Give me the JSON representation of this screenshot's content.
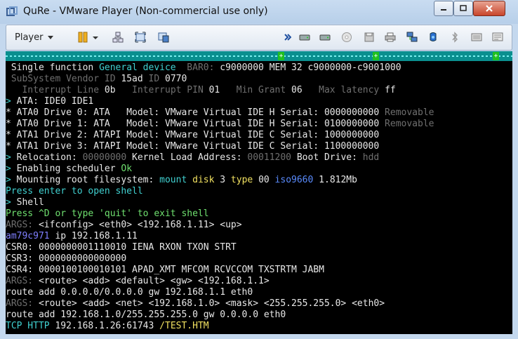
{
  "window": {
    "title": "QuRe - VMware Player (Non-commercial use only)",
    "controls": [
      "minimize",
      "maximize",
      "close"
    ]
  },
  "toolbar": {
    "player_label": "Player",
    "icons": [
      "pause-icon",
      "send-ctrl-alt-del-icon",
      "fullscreen-icon",
      "unity-icon",
      "arrows-icon",
      "hard-disk-icon",
      "hard-disk-2-icon",
      "cd-drive-icon",
      "floppy-icon",
      "network-icon",
      "usb-icon",
      "sound-icon",
      "bluetooth-icon",
      "printer-icon",
      "message-icon"
    ]
  },
  "terminal": {
    "lines": [
      [
        {
          "t": "Single function ",
          "c": "w",
          "p": " "
        },
        {
          "t": "General device",
          "c": "c"
        },
        {
          "t": "  BAR0: ",
          "c": "g"
        },
        {
          "t": "c9000000 MEM 32 c9000000-c9001000",
          "c": "w"
        }
      ],
      [
        {
          "t": "SubSystem Vendor ID ",
          "c": "g",
          "p": " "
        },
        {
          "t": "15ad",
          "c": "w"
        },
        {
          "t": " ID ",
          "c": "g"
        },
        {
          "t": "0770",
          "c": "w"
        }
      ],
      [
        {
          "t": "Interrupt Line ",
          "c": "g",
          "p": "   "
        },
        {
          "t": "0b",
          "c": "w"
        },
        {
          "t": "   Interrupt PIN ",
          "c": "g"
        },
        {
          "t": "01",
          "c": "w"
        },
        {
          "t": "   Min Grant ",
          "c": "g"
        },
        {
          "t": "06",
          "c": "w"
        },
        {
          "t": "   Max latency ",
          "c": "g"
        },
        {
          "t": "ff",
          "c": "w"
        }
      ],
      [
        {
          "t": ">",
          "c": "c"
        },
        {
          "t": " ATA: IDE0 IDE1",
          "c": "w"
        }
      ],
      [
        {
          "t": "*",
          "c": "w"
        },
        {
          "t": " ATA0 Drive 0: ATA   Model: VMware Virtual IDE H Serial: 0000000000 ",
          "c": "w"
        },
        {
          "t": "Removable",
          "c": "g"
        }
      ],
      [
        {
          "t": "*",
          "c": "w"
        },
        {
          "t": " ATA0 Drive 1: ATA   Model: VMware Virtual IDE H Serial: 0100000000 ",
          "c": "w"
        },
        {
          "t": "Removable",
          "c": "g"
        }
      ],
      [
        {
          "t": "*",
          "c": "w"
        },
        {
          "t": " ATA1 Drive 2: ATAPI Model: VMware Virtual IDE C Serial: 1000000000",
          "c": "w"
        }
      ],
      [
        {
          "t": "*",
          "c": "w"
        },
        {
          "t": " ATA1 Drive 3: ATAPI Model: VMware Virtual IDE C Serial: 1100000000",
          "c": "w"
        }
      ],
      [
        {
          "t": ">",
          "c": "c"
        },
        {
          "t": " Relocation: ",
          "c": "w"
        },
        {
          "t": "00000000",
          "c": "g"
        },
        {
          "t": " Kernel Load Address: ",
          "c": "w"
        },
        {
          "t": "00011200",
          "c": "g"
        },
        {
          "t": " Boot Drive: ",
          "c": "w"
        },
        {
          "t": "hdd",
          "c": "g"
        }
      ],
      [
        {
          "t": ">",
          "c": "c"
        },
        {
          "t": " Enabling scheduler ",
          "c": "w"
        },
        {
          "t": "Ok",
          "c": "gr"
        }
      ],
      [
        {
          "t": ">",
          "c": "c"
        },
        {
          "t": " Mounting root filesystem: ",
          "c": "w"
        },
        {
          "t": "mount ",
          "c": "c"
        },
        {
          "t": "disk ",
          "c": "y"
        },
        {
          "t": "3 ",
          "c": "w"
        },
        {
          "t": "type ",
          "c": "y"
        },
        {
          "t": "00 ",
          "c": "w"
        },
        {
          "t": "iso9660",
          "c": "bl"
        },
        {
          "t": " 1.812Mb",
          "c": "w"
        }
      ],
      [
        {
          "t": "Press enter to open shell",
          "c": "c"
        }
      ],
      [
        {
          "t": ">",
          "c": "c"
        },
        {
          "t": " Shell",
          "c": "w"
        }
      ],
      [
        {
          "t": "Press ^D or type 'quit' to exit shell",
          "c": "gr"
        }
      ],
      [
        {
          "t": "ARGS: ",
          "c": "g"
        },
        {
          "t": "<ifconfig> <eth0> <192.168.1.11> <up>",
          "c": "w"
        }
      ],
      [
        {
          "t": "am79c971",
          "c": "b"
        },
        {
          "t": " ip 192.168.1.11",
          "c": "w"
        }
      ],
      [
        {
          "t": "CSR0: 0000000001110010 IENA RXON TXON STRT",
          "c": "w"
        }
      ],
      [
        {
          "t": "CSR3: 0000000000000000",
          "c": "w"
        }
      ],
      [
        {
          "t": "CSR4: 0000100100010101 APAD_XMT MFCOM RCVCCOM TXSTRTM JABM",
          "c": "w"
        }
      ],
      [
        {
          "t": "ARGS: ",
          "c": "g"
        },
        {
          "t": "<route> <add> <default> <gw> <192.168.1.1>",
          "c": "w"
        }
      ],
      [
        {
          "t": "route add 0.0.0.0/0.0.0.0 gw 192.168.1.1 eth0",
          "c": "w"
        }
      ],
      [
        {
          "t": "ARGS: ",
          "c": "g"
        },
        {
          "t": "<route> <add> <net> <192.168.1.0> <mask> <255.255.255.0> <eth0>",
          "c": "w"
        }
      ],
      [
        {
          "t": "route add 192.168.1.0/255.255.255.0 gw 0.0.0.0 eth0",
          "c": "w"
        }
      ],
      [
        {
          "t": "TCP HTTP ",
          "c": "c"
        },
        {
          "t": "192.168.1.26:61743 ",
          "c": "w"
        },
        {
          "t": "/TEST.HTM",
          "c": "y"
        }
      ]
    ]
  }
}
